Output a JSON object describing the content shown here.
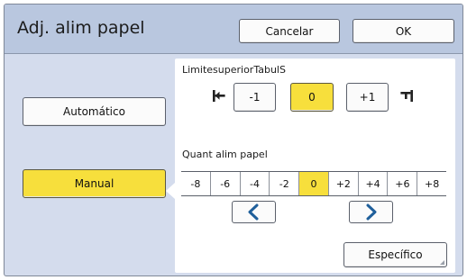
{
  "header": {
    "title": "Adj. alim papel",
    "cancel_label": "Cancelar",
    "ok_label": "OK"
  },
  "modes": {
    "auto_label": "Automático",
    "manual_label": "Manual",
    "selected": "Manual"
  },
  "tab_limit": {
    "label": "LimitesuperiorTabulS",
    "left_icon": "align-left-icon",
    "right_icon": "align-right-icon",
    "options": [
      "-1",
      "0",
      "+1"
    ],
    "selected": "0"
  },
  "feed_amount": {
    "label": "Quant alim papel",
    "values": [
      "-8",
      "-6",
      "-4",
      "-2",
      "0",
      "+2",
      "+4",
      "+6",
      "+8"
    ],
    "selected": "0",
    "prev_icon": "chevron-left-icon",
    "next_icon": "chevron-right-icon"
  },
  "specific_label": "Específico",
  "colors": {
    "accent": "#f7df3c",
    "header": "#b9c7df",
    "background": "#d4dced",
    "arrow": "#1f5f9b"
  }
}
